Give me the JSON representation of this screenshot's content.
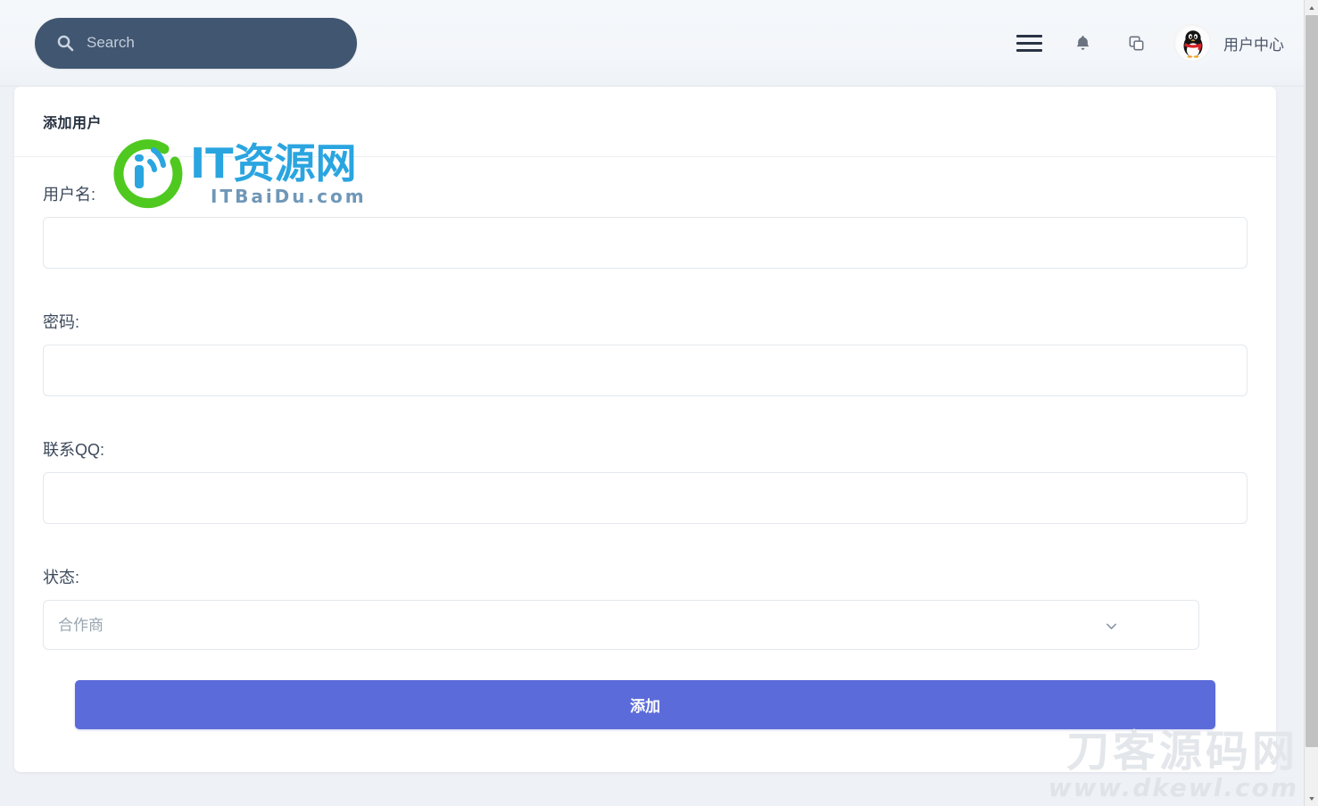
{
  "header": {
    "search": {
      "placeholder": "Search",
      "value": "",
      "icon": "search-icon"
    },
    "icons": [
      {
        "name": "hamburger-menu-icon",
        "label": "菜单"
      },
      {
        "name": "bell-notification-icon",
        "label": "通知"
      },
      {
        "name": "windows-copy-icon",
        "label": "窗口"
      }
    ],
    "avatar_alt": "QQ头像",
    "user_center_label": "用户中心",
    "background_color": "#f4f7fa",
    "search_background_color": "#415670"
  },
  "card": {
    "title": "添加用户",
    "fields": [
      {
        "label": "用户名:",
        "value": "",
        "placeholder": "",
        "type": "text",
        "name": "username"
      },
      {
        "label": "密码:",
        "value": "",
        "placeholder": "",
        "type": "text",
        "name": "password"
      },
      {
        "label": "联系QQ:",
        "value": "",
        "placeholder": "",
        "type": "text",
        "name": "qq"
      }
    ],
    "status_field": {
      "label": "状态:",
      "selected": "合作商",
      "options": [
        "合作商"
      ]
    },
    "submit_label": "添加",
    "submit_color": "#5c6bda"
  },
  "watermark_logo": {
    "title": "IT资源网",
    "subtitle": "ITBaiDu.com",
    "ring_color": "#4fc91f",
    "text_color": "#2aa5e0",
    "subtitle_color": "#6f97b8"
  },
  "watermark_corner": {
    "title": "刀客源码网",
    "url": "www.dkewl.com",
    "color": "#e3e6ea"
  },
  "scrollbar": {
    "up_arrow": "▲",
    "down_arrow": "▼"
  }
}
